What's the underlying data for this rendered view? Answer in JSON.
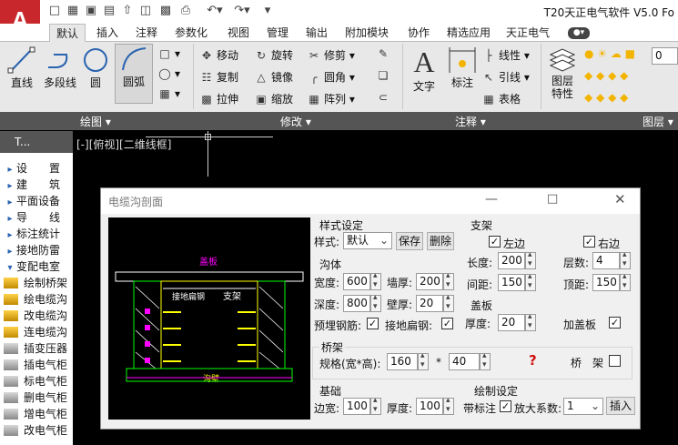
{
  "app": {
    "title": "T20天正电气软件 V5.0 Fo",
    "logo": "A"
  },
  "tabs": [
    "默认",
    "插入",
    "注释",
    "参数化",
    "视图",
    "管理",
    "输出",
    "附加模块",
    "协作",
    "精选应用",
    "天正电气"
  ],
  "active_tab": "默认",
  "draw_group": {
    "line": "直线",
    "polyline": "多段线",
    "circle": "圆",
    "arc": "圆弧",
    "label": "绘图"
  },
  "modify_group": {
    "move": "移动",
    "rotate": "旋转",
    "trim": "修剪",
    "copy": "复制",
    "mirror": "镜像",
    "fillet": "圆角",
    "stretch": "拉伸",
    "scale": "缩放",
    "array": "阵列",
    "label": "修改"
  },
  "annot_group": {
    "text": "文字",
    "dim": "标注",
    "linear": "线性",
    "leader": "引线",
    "table": "表格",
    "label": "注释"
  },
  "layer_group": {
    "props": "图层特性",
    "layer_value": "0",
    "label": "图层"
  },
  "sidebar": {
    "header": "T...",
    "items": [
      "设　　置",
      "建　　筑",
      "平面设备",
      "导　　线",
      "标注统计",
      "接地防雷",
      "变配电室",
      "绘制桥架",
      "绘电缆沟",
      "改电缆沟",
      "连电缆沟",
      "插变压器",
      "插电气柜",
      "标电气柜",
      "删电气柜",
      "增电气柜",
      "改电气柜"
    ]
  },
  "viewport_label": "[-][俯视][二维线框]",
  "dialog": {
    "title": "电缆沟剖面",
    "style_section": "样式设定",
    "style_label": "样式:",
    "style_value": "默认",
    "save_btn": "保存",
    "delete_btn": "删除",
    "trench_section": "沟体",
    "width_label": "宽度:",
    "width_value": "600",
    "wall_label": "墙厚:",
    "wall_value": "200",
    "depth_label": "深度:",
    "depth_value": "800",
    "side_label": "壁厚:",
    "side_value": "20",
    "embed_label": "预埋钢筋:",
    "embed_checked": "✓",
    "flat_label": "接地扁钢:",
    "flat_checked": "✓",
    "support_section": "支架",
    "left_label": "左边",
    "left_checked": "✓",
    "right_label": "右边",
    "right_checked": "✓",
    "length_label": "长度:",
    "length_value": "200",
    "layers_label": "层数:",
    "layers_value": "4",
    "spacing_label": "间距:",
    "spacing_value": "150",
    "top_label": "顶距:",
    "top_value": "150",
    "cover_section": "盖板",
    "thick_label": "厚度:",
    "thick_value": "20",
    "add_cover_label": "加盖板",
    "add_cover_checked": "✓",
    "tray_section": "桥架",
    "spec_label": "规格(宽*高):",
    "spec_w": "160",
    "spec_x": "*",
    "spec_h": "40",
    "tray_help": "?",
    "tray_label": "桥　架",
    "base_section": "基础",
    "edge_label": "边宽:",
    "edge_value": "100",
    "base_thick_label": "厚度:",
    "base_thick_value": "100",
    "drawset_section": "绘制设定",
    "annot_label": "带标注",
    "annot_checked": "✓",
    "scale_label": "放大系数:",
    "scale_value": "1",
    "insert_btn": "插入",
    "preview": {
      "cover": "盖板",
      "rail": "接地扁钢",
      "bracket": "支架",
      "bottom": "沟壁"
    }
  },
  "colors": {
    "accent": "#c8282c",
    "ribbon": "#e8e8e8",
    "group_bar": "#555555",
    "yellow": "#ffff00",
    "magenta": "#ff00ff",
    "green": "#00ff00"
  }
}
